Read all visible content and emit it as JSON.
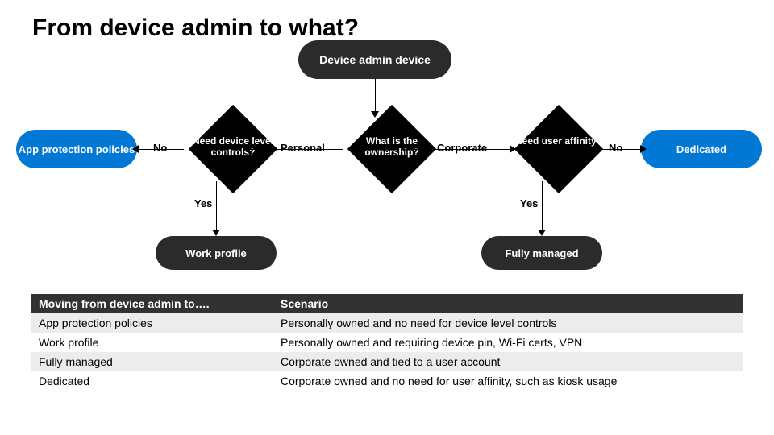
{
  "title": "From device admin to what?",
  "flow": {
    "source": "Device admin device",
    "decisions": {
      "controls": "Need device level controls?",
      "ownership": "What is the ownership?",
      "affinity": "Need user affinity?"
    },
    "outcomes": {
      "app_protection": "App protection policies",
      "work_profile": "Work profile",
      "fully_managed": "Fully managed",
      "dedicated": "Dedicated"
    },
    "edges": {
      "controls_no": "No",
      "controls_yes": "Yes",
      "ownership_personal": "Personal",
      "ownership_corporate": "Corporate",
      "affinity_no": "No",
      "affinity_yes": "Yes"
    }
  },
  "table": {
    "headers": {
      "c1": "Moving from device admin to….",
      "c2": "Scenario"
    },
    "rows": [
      {
        "c1": "App protection policies",
        "c2": "Personally owned and no need for device level controls"
      },
      {
        "c1": "Work profile",
        "c2": "Personally owned and requiring device pin, Wi-Fi certs, VPN"
      },
      {
        "c1": "Fully managed",
        "c2": "Corporate owned and tied to a user account"
      },
      {
        "c1": "Dedicated",
        "c2": "Corporate owned and no need for user affinity, such as kiosk usage"
      }
    ]
  },
  "colors": {
    "dark": "#2b2b2b",
    "blue": "#0078d4",
    "header": "#323232",
    "row_alt": "#ececec"
  }
}
